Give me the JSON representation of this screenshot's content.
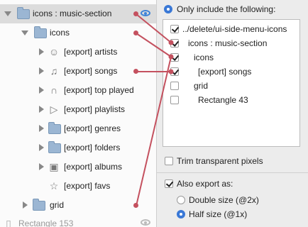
{
  "tree": {
    "rows": [
      {
        "label": "icons : music-section",
        "icon": "folder-icon",
        "expanded": true,
        "selected": true
      },
      {
        "label": "icons",
        "icon": "folder-icon",
        "expanded": true
      },
      {
        "label": "[export] artists",
        "icon": "users-icon"
      },
      {
        "label": "[export] songs",
        "icon": "music-note-icon"
      },
      {
        "label": "[export] top played",
        "icon": "headphones-icon"
      },
      {
        "label": "[export] playlists",
        "icon": "playlist-icon"
      },
      {
        "label": "[export] genres",
        "icon": "folder-icon"
      },
      {
        "label": "[export] folders",
        "icon": "folder-icon"
      },
      {
        "label": "[export] albums",
        "icon": "album-icon"
      },
      {
        "label": "[export] favs",
        "icon": "star-icon"
      },
      {
        "label": "grid",
        "icon": "folder-icon"
      },
      {
        "label": "Rectangle 153",
        "icon": "rectangle-icon"
      }
    ]
  },
  "panel": {
    "only_include_label": "Only include the following:",
    "items": [
      {
        "label": "../delete/ui-side-menu-icons",
        "checked": true
      },
      {
        "label": "icons : music-section",
        "checked": true
      },
      {
        "label": "icons",
        "checked": true
      },
      {
        "label": "[export] songs",
        "checked": true
      },
      {
        "label": "grid",
        "checked": false
      },
      {
        "label": "Rectangle 43",
        "checked": false
      }
    ],
    "trim_label": "Trim transparent pixels",
    "also_export_label": "Also export as:",
    "double_size_label": "Double size (@2x)",
    "half_size_label": "Half size (@1x)"
  },
  "colors": {
    "link": "#c4515f",
    "accent": "#3a78d6"
  }
}
